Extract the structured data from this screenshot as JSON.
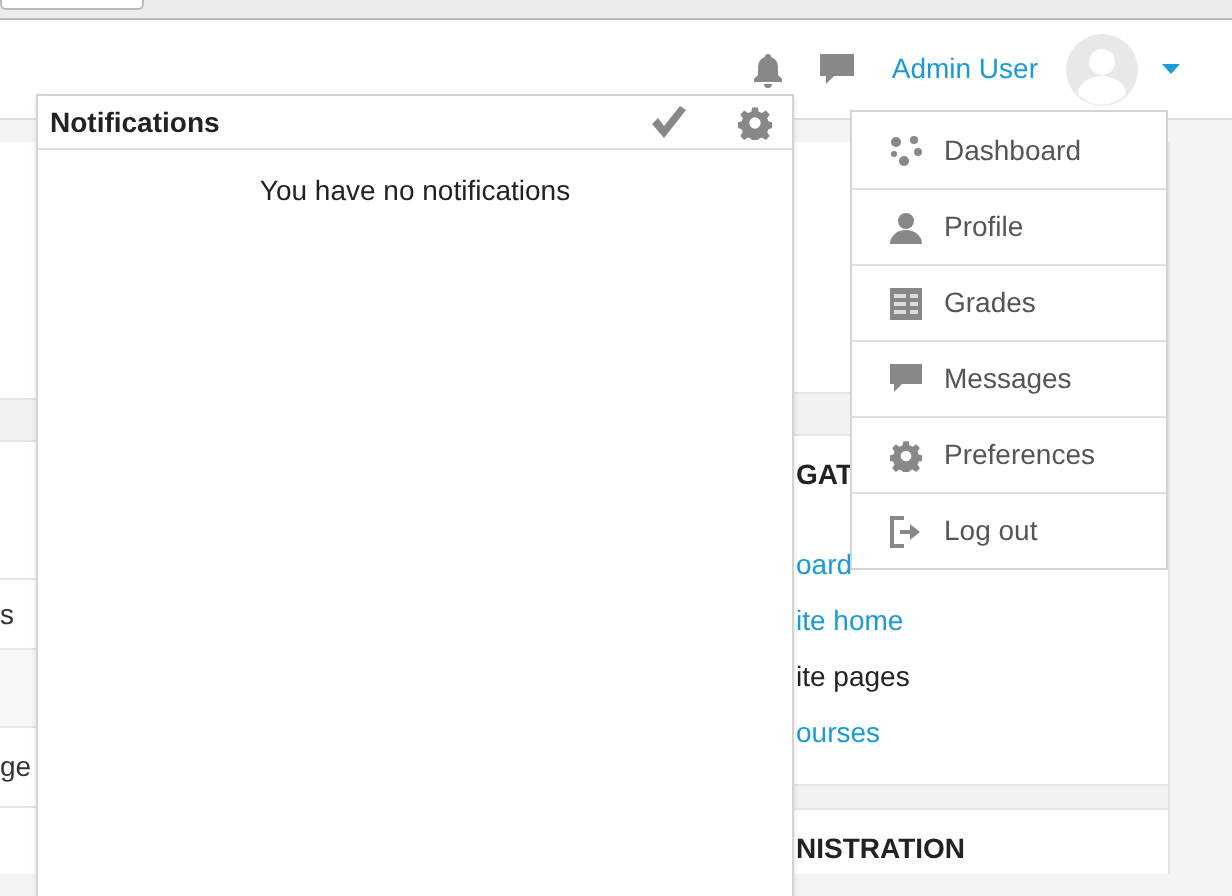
{
  "header": {
    "user_name": "Admin User"
  },
  "notifications": {
    "title": "Notifications",
    "empty_message": "You have no notifications"
  },
  "user_menu": [
    {
      "label": "Dashboard"
    },
    {
      "label": "Profile"
    },
    {
      "label": "Grades"
    },
    {
      "label": "Messages"
    },
    {
      "label": "Preferences"
    },
    {
      "label": "Log out"
    }
  ],
  "background": {
    "left_rows": [
      "s",
      "ge"
    ],
    "navigation_block": {
      "title": "GAT",
      "items": [
        {
          "text": "oard",
          "kind": "link"
        },
        {
          "text": "ite home",
          "kind": "link"
        },
        {
          "text": "ite pages",
          "kind": "text"
        },
        {
          "text": "ourses",
          "kind": "link"
        }
      ]
    },
    "administration_block": {
      "title": "NISTRATION"
    }
  }
}
